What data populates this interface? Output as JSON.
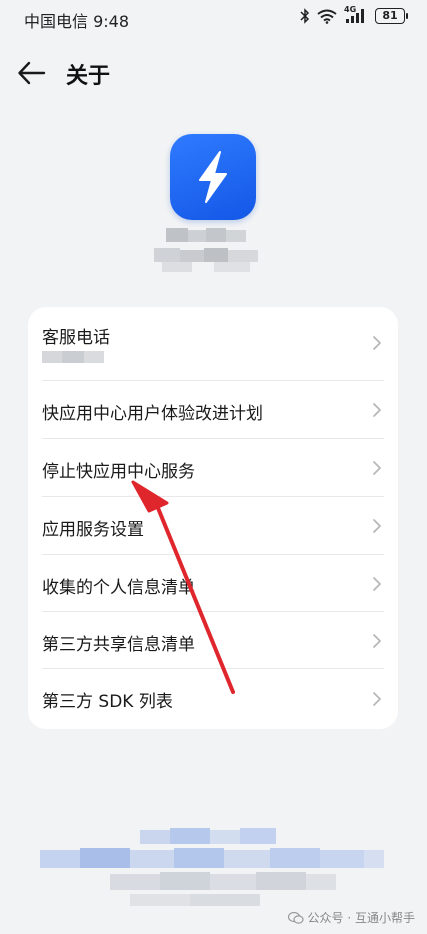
{
  "status_bar": {
    "carrier_time": "中国电信 9:48",
    "network": "4G",
    "battery": "81"
  },
  "header": {
    "title": "关于"
  },
  "menu": {
    "items": [
      {
        "label": "客服电话",
        "icon": "chevron-right-icon"
      },
      {
        "label": "快应用中心用户体验改进计划",
        "icon": "chevron-right-icon"
      },
      {
        "label": "停止快应用中心服务",
        "icon": "chevron-right-icon"
      },
      {
        "label": "应用服务设置",
        "icon": "chevron-right-icon"
      },
      {
        "label": "收集的个人信息清单",
        "icon": "chevron-right-icon"
      },
      {
        "label": "第三方共享信息清单",
        "icon": "chevron-right-icon"
      },
      {
        "label": "第三方 SDK 列表",
        "icon": "chevron-right-icon"
      }
    ]
  },
  "watermark": {
    "text": "公众号 · 互通小帮手"
  },
  "colors": {
    "background": "#f1f3f5",
    "card": "#ffffff",
    "app_icon": "#1a62f0",
    "annotation_arrow": "#e0262d"
  }
}
